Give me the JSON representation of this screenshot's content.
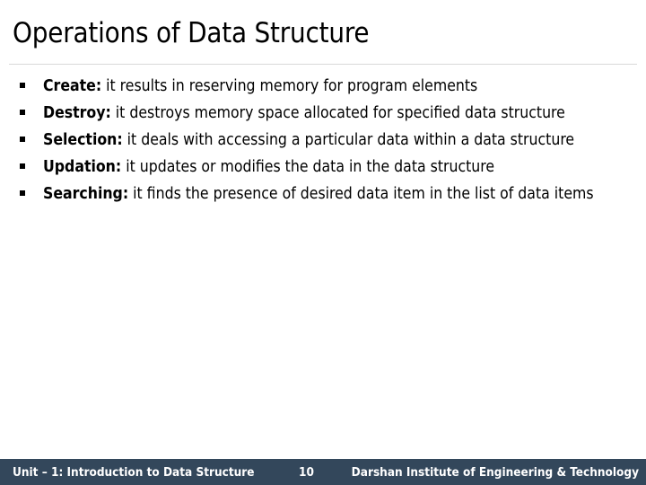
{
  "slide": {
    "title": "Operations of Data Structure",
    "bullet_marker_glyph": "square-bullet",
    "bullets": [
      {
        "term": "Create:",
        "rest": " it results in reserving memory for program elements"
      },
      {
        "term": "Destroy:",
        "rest": " it destroys memory space allocated for specified data structure"
      },
      {
        "term": "Selection:",
        "rest": " it deals with accessing a particular data within a data structure"
      },
      {
        "term": "Updation:",
        "rest": " it updates or modifies the data in the data structure"
      },
      {
        "term": "Searching:",
        "rest": " it finds the presence of desired data item in the list of data items"
      }
    ]
  },
  "footer": {
    "left": "Unit – 1: Introduction to Data Structure",
    "page_number": "10",
    "right": "Darshan Institute of Engineering & Technology",
    "background_color": "#33475b",
    "text_color": "#ffffff"
  },
  "colors": {
    "title_text": "#000000",
    "body_text": "#000000",
    "rule": "#d9d9d9",
    "page_background": "#ffffff"
  }
}
